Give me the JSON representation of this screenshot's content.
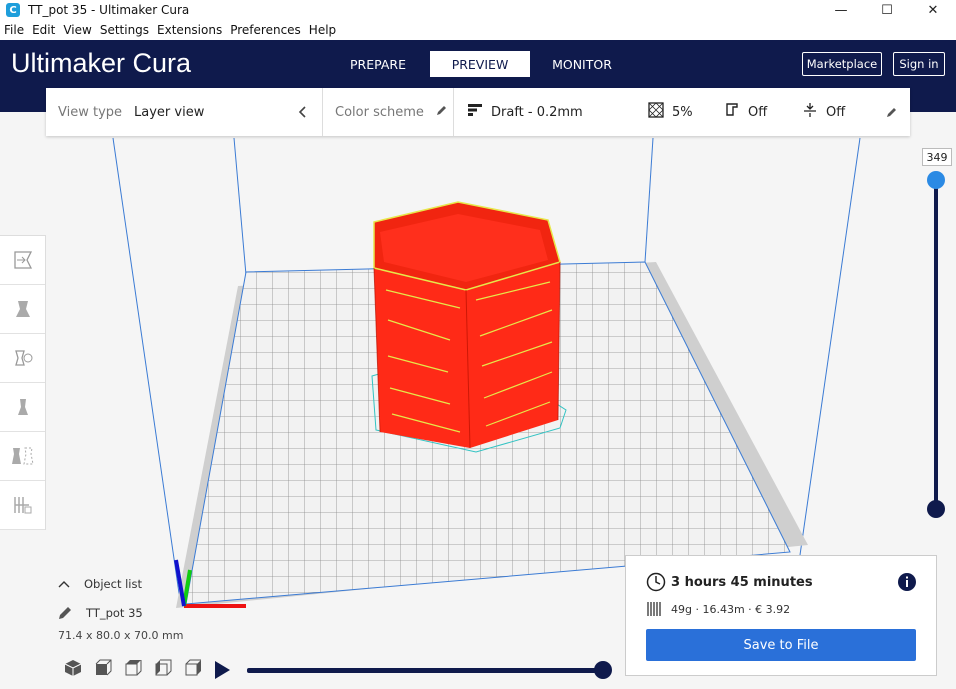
{
  "window": {
    "title": "TT_pot 35  - Ultimaker Cura",
    "app_icon_letter": "C",
    "minimize": "—",
    "maximize": "☐",
    "close": "✕"
  },
  "menu": [
    "File",
    "Edit",
    "View",
    "Settings",
    "Extensions",
    "Preferences",
    "Help"
  ],
  "header": {
    "logo_bold": "Ultimaker",
    "logo_light": "Cura",
    "tabs": [
      {
        "label": "PREPARE",
        "active": false
      },
      {
        "label": "PREVIEW",
        "active": true
      },
      {
        "label": "MONITOR",
        "active": false
      }
    ],
    "marketplace": "Marketplace",
    "signin": "Sign in",
    "color": "#0f1a4c"
  },
  "topbar": {
    "view_type_label": "View type",
    "view_type_value": "Layer view",
    "color_scheme_label": "Color scheme",
    "profile": "Draft - 0.2mm",
    "infill": "5%",
    "support": "Off",
    "adhesion": "Off"
  },
  "layer_slider": {
    "value": "349"
  },
  "object_list": {
    "label": "Object list",
    "object_name": "TT_pot 35",
    "dimensions": "71.4 x 80.0 x 70.0 mm"
  },
  "print_info": {
    "time": "3 hours 45 minutes",
    "material": "49g · 16.43m · € 3.92",
    "save": "Save to File",
    "accent": "#2a70d9"
  },
  "model": {
    "color": "#ff2a17",
    "layer_color": "#e7e74a"
  },
  "icons": [
    "clock-icon",
    "info-icon",
    "spool-icon",
    "pencil-icon",
    "chevron-left-icon",
    "infill-icon",
    "support-icon",
    "adhesion-icon",
    "profile-icon",
    "play-icon"
  ]
}
